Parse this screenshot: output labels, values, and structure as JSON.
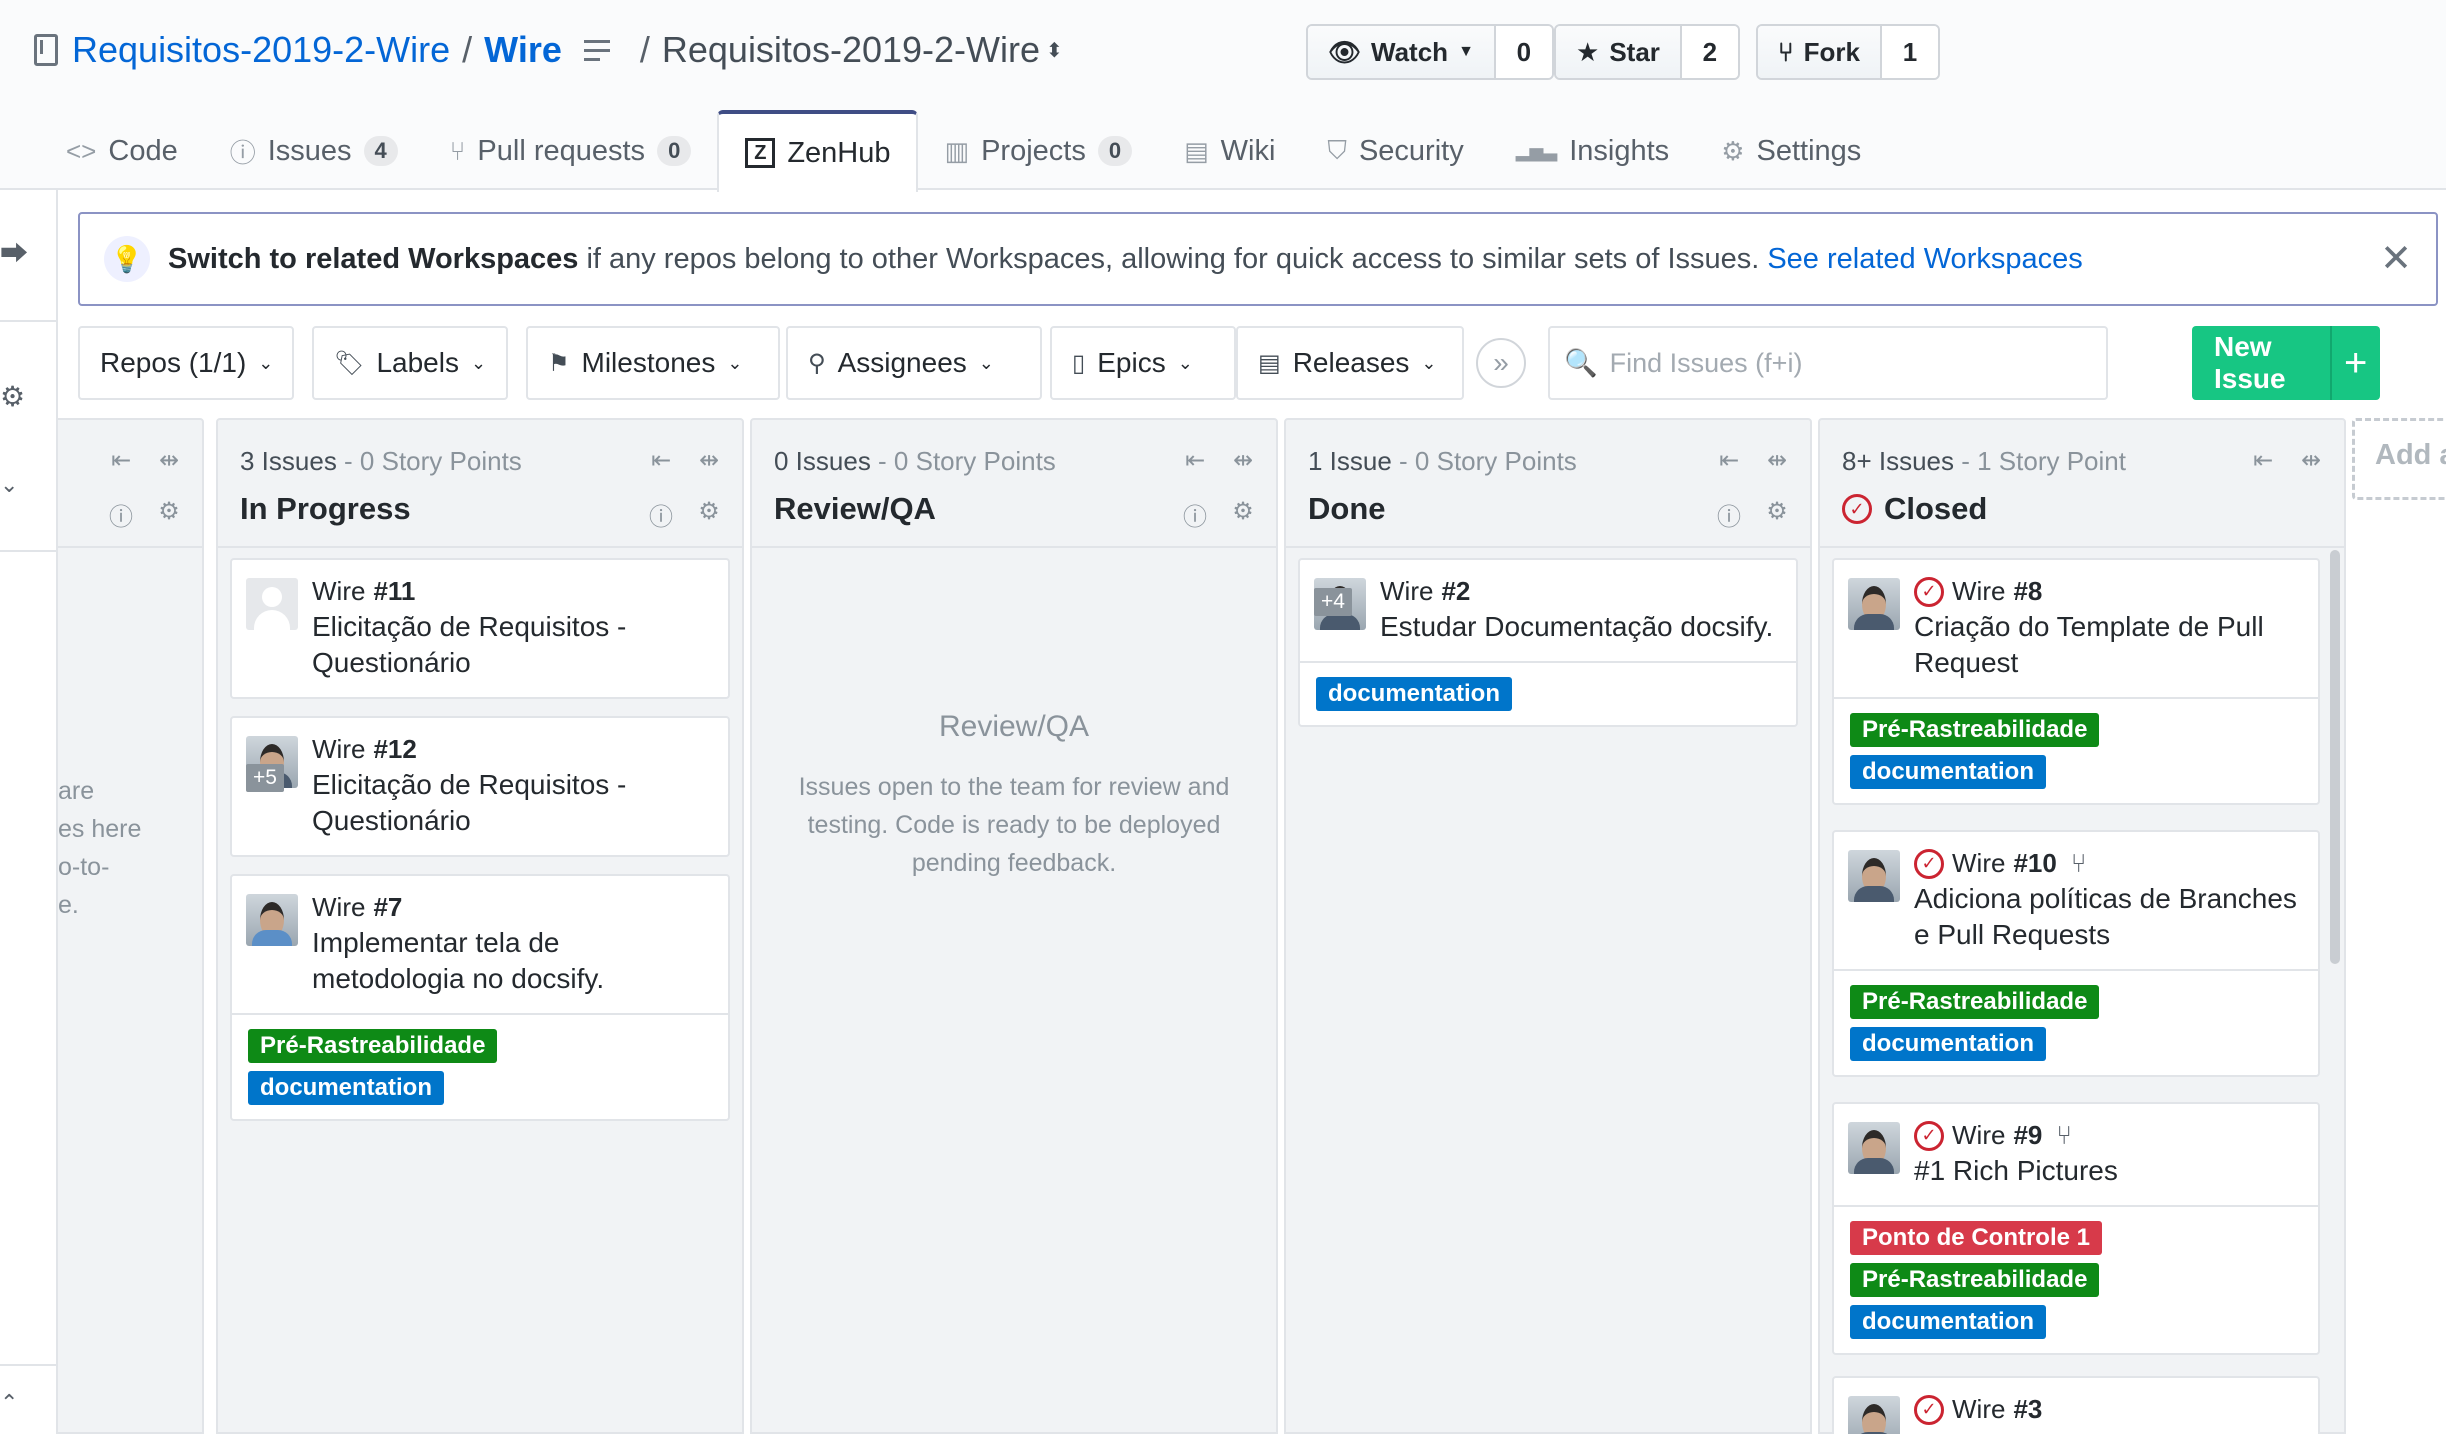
{
  "repo": {
    "owner": "Requisitos-2019-2-Wire",
    "separator": "/",
    "name": "Wire",
    "path_sep": "/",
    "workspace": "Requisitos-2019-2-Wire",
    "workspace_caret": "⬍"
  },
  "actions": {
    "watch": {
      "label": "Watch",
      "count": "0"
    },
    "star": {
      "label": "Star",
      "count": "2"
    },
    "fork": {
      "label": "Fork",
      "count": "1"
    }
  },
  "tabs": [
    {
      "label": "Code",
      "icon": "code-icon",
      "glyph": "<>"
    },
    {
      "label": "Issues",
      "count": "4",
      "icon": "issue-icon",
      "glyph": "ⓘ"
    },
    {
      "label": "Pull requests",
      "count": "0",
      "icon": "pr-icon",
      "glyph": "⑂"
    },
    {
      "label": "ZenHub",
      "icon": "zenhub-icon",
      "glyph": "Z"
    },
    {
      "label": "Projects",
      "count": "0",
      "icon": "project-icon",
      "glyph": "▥"
    },
    {
      "label": "Wiki",
      "icon": "book-icon",
      "glyph": "▤"
    },
    {
      "label": "Security",
      "icon": "shield-icon",
      "glyph": "⛉"
    },
    {
      "label": "Insights",
      "icon": "graph-icon",
      "glyph": "▂▅▃"
    },
    {
      "label": "Settings",
      "icon": "gear-icon",
      "glyph": "⚙"
    }
  ],
  "banner": {
    "bold": "Switch to related Workspaces",
    "text": "if any repos belong to other Workspaces, allowing for quick access to similar sets of Issues.",
    "link": "See related Workspaces",
    "close": "✕"
  },
  "filters": {
    "repos": "Repos (1/1)",
    "labels": "Labels",
    "milestones": "Milestones",
    "assignees": "Assignees",
    "epics": "Epics",
    "releases": "Releases",
    "search_placeholder": "Find Issues (f+i)",
    "new_issue": "New Issue",
    "plus": "+"
  },
  "partial_pipeline": {
    "lines": [
      "are",
      "es here",
      "o-to-",
      "e."
    ]
  },
  "pipelines": [
    {
      "count": "3 Issues",
      "points": " - 0 Story Points",
      "name": "In Progress",
      "cards": [
        {
          "repo": "Wire",
          "num": "#11",
          "title": "Elicitação de Requisitos - Questionário",
          "labels": []
        },
        {
          "repo": "Wire",
          "num": "#12",
          "title": "Elicitação de Requisitos - Questionário",
          "more": "+5",
          "labels": []
        },
        {
          "repo": "Wire",
          "num": "#7",
          "title": "Implementar tela de metodologia no docsify.",
          "labels": [
            "Pré-Rastreabilidade",
            "documentation"
          ]
        }
      ]
    },
    {
      "count": "0 Issues",
      "points": " - 0 Story Points",
      "name": "Review/QA",
      "empty_title": "Review/QA",
      "empty_desc": "Issues open to the team for review and testing. Code is ready to be deployed pending feedback."
    },
    {
      "count": "1 Issue",
      "points": " - 0 Story Points",
      "name": "Done",
      "cards": [
        {
          "repo": "Wire",
          "num": "#2",
          "title": "Estudar Documentação docsify.",
          "more": "+4",
          "labels": [
            "documentation"
          ]
        }
      ]
    },
    {
      "count": "8+ Issues",
      "points": " - 1 Story Point",
      "name": "Closed",
      "cards": [
        {
          "repo": "Wire",
          "num": "#8",
          "title": "Criação do Template de Pull Request",
          "labels": [
            "Pré-Rastreabilidade",
            "documentation"
          ]
        },
        {
          "repo": "Wire",
          "num": "#10",
          "title": "Adiciona políticas de Branches e Pull Requests",
          "labels": [
            "Pré-Rastreabilidade",
            "documentation"
          ]
        },
        {
          "repo": "Wire",
          "num": "#9",
          "title": "#1 Rich Pictures",
          "labels": [
            "Ponto de Controle 1",
            "Pré-Rastreabilidade",
            "documentation"
          ]
        },
        {
          "repo": "Wire",
          "num": "#3",
          "title": "",
          "labels": []
        }
      ]
    }
  ],
  "add_pipeline": "Add a",
  "label_colors": {
    "Pré-Rastreabilidade": "#0e8a16",
    "documentation": "#0075ca",
    "Ponto de Controle 1": "#d73a4a"
  },
  "colors": {
    "accent": "#0366d6",
    "zenhub_tab": "#3f4d85",
    "new_issue": "#17c683",
    "closed": "#cb2431"
  }
}
